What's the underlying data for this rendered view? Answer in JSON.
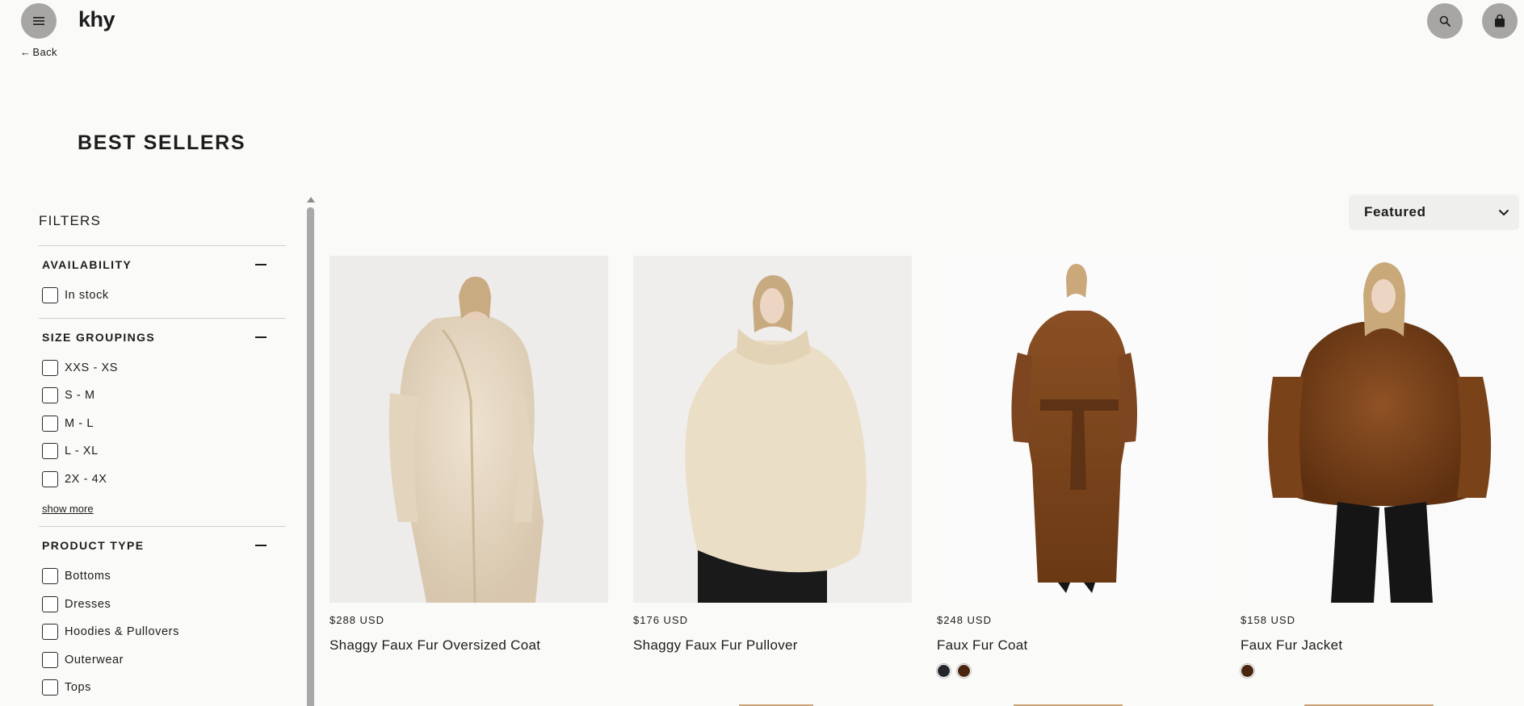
{
  "header": {
    "logo": "khy",
    "back_label": "Back",
    "menu_icon": "hamburger-menu-icon",
    "search_icon": "search-icon",
    "cart_icon": "shopping-bag-icon"
  },
  "page": {
    "title": "BEST SELLERS"
  },
  "filters": {
    "heading": "FILTERS",
    "groups": [
      {
        "title": "AVAILABILITY",
        "options": [
          "In stock"
        ]
      },
      {
        "title": "SIZE GROUPINGS",
        "options": [
          "XXS - XS",
          "S - M",
          "M - L",
          "L - XL",
          "2X - 4X"
        ],
        "show_more": "show more"
      },
      {
        "title": "PRODUCT TYPE",
        "options": [
          "Bottoms",
          "Dresses",
          "Hoodies & Pullovers",
          "Outerwear",
          "Tops"
        ]
      }
    ]
  },
  "sort": {
    "selected": "Featured"
  },
  "products": [
    {
      "price": "$288 USD",
      "name": "Shaggy Faux Fur Oversized Coat",
      "swatches": []
    },
    {
      "price": "$176 USD",
      "name": "Shaggy Faux Fur Pullover",
      "swatches": []
    },
    {
      "price": "$248 USD",
      "name": "Faux Fur Coat",
      "swatches": [
        "#23262b",
        "#4a2610"
      ]
    },
    {
      "price": "$158 USD",
      "name": "Faux Fur Jacket",
      "swatches": [
        "#4a2610"
      ]
    }
  ],
  "colors": {
    "background": "#fafaf8",
    "icon_button": "#a8a6a4",
    "text": "#1c1c1c"
  }
}
